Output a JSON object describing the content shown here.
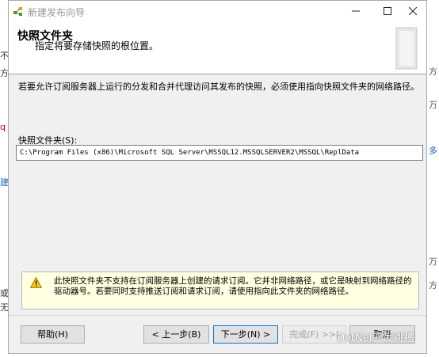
{
  "window": {
    "title": "新建发布向导"
  },
  "header": {
    "title": "快照文件夹",
    "subtitle": "指定将要存储快照的根位置。"
  },
  "main": {
    "description": "若要允许订阅服务器上运行的分发和合并代理访问其发布的快照，必须使用指向快照文件夹的网络路径。",
    "folder_label": "快照文件夹(S):",
    "folder_value": "C:\\Program Files (x86)\\Microsoft SQL Server\\MSSQL12.MSSQLSERVER2\\MSSQL\\ReplData"
  },
  "warning": {
    "text": "此快照文件夹不支持在订阅服务器上创建的请求订阅。它并非网络路径，或它是映射到网络路径的驱动器号。若要同时支持推送订阅和请求订阅，请使用指向此文件夹的网络路径。"
  },
  "buttons": {
    "help": "帮助(H)",
    "back": "< 上一步(B)",
    "next": "下一步(N) >",
    "finish": "完成(F) >>|",
    "cancel": "取消"
  },
  "background": {
    "left_fragments": [
      "不",
      "方",
      "q",
      "建",
      "或",
      "无"
    ],
    "right_fragments": [
      "方",
      "万",
      "多",
      "万",
      "方"
    ]
  },
  "watermark": "DotNet开发跳槽",
  "colors": {
    "primary_border": "#0078d7",
    "warning_bg": "#ffffe1"
  }
}
